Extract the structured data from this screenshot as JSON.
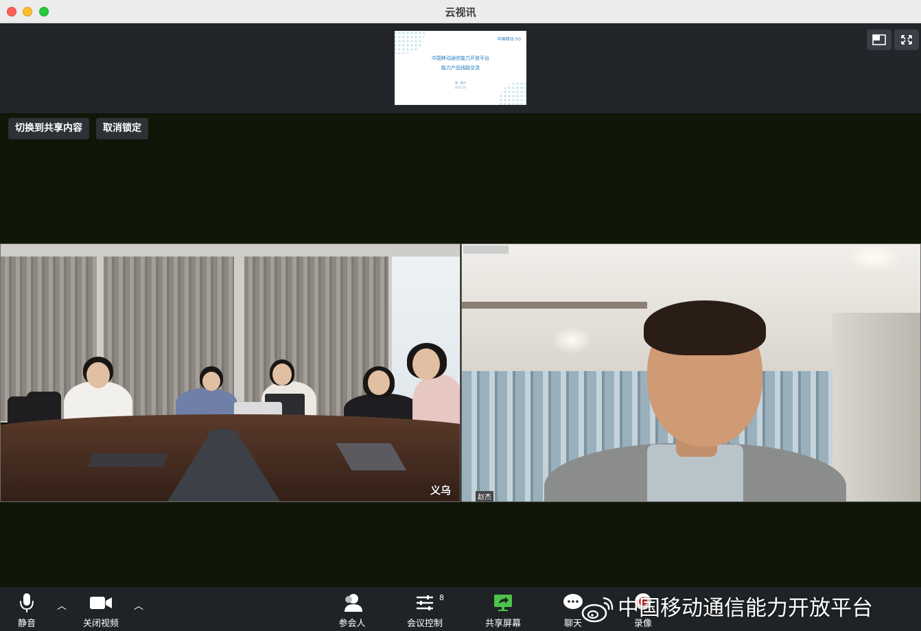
{
  "window": {
    "title": "云视讯"
  },
  "shared_slide": {
    "logo_text": "中国移动 5G",
    "line1": "中国移动通信能力开放平台",
    "line2": "能力产品线路交流",
    "line3": "和 ·  能力",
    "line4": "2021.05"
  },
  "overlay_buttons": {
    "switch_label": "切换到共享内容",
    "unlock_label": "取消锁定"
  },
  "tiles": {
    "left_name": "义乌",
    "right_name": "赵杰"
  },
  "toolbar": {
    "mute_label": "静音",
    "video_label": "关闭视频",
    "participants_label": "参会人",
    "control_label": "会议控制",
    "control_count": "8",
    "share_label": "共享屏幕",
    "chat_label": "聊天",
    "record_label": "录像"
  },
  "watermark": {
    "text": "中国移动通信能力开放平台"
  },
  "colors": {
    "toolbar_bg": "#1f2326",
    "share_icon": "#4cc34a",
    "record_dot": "#e0302a"
  }
}
